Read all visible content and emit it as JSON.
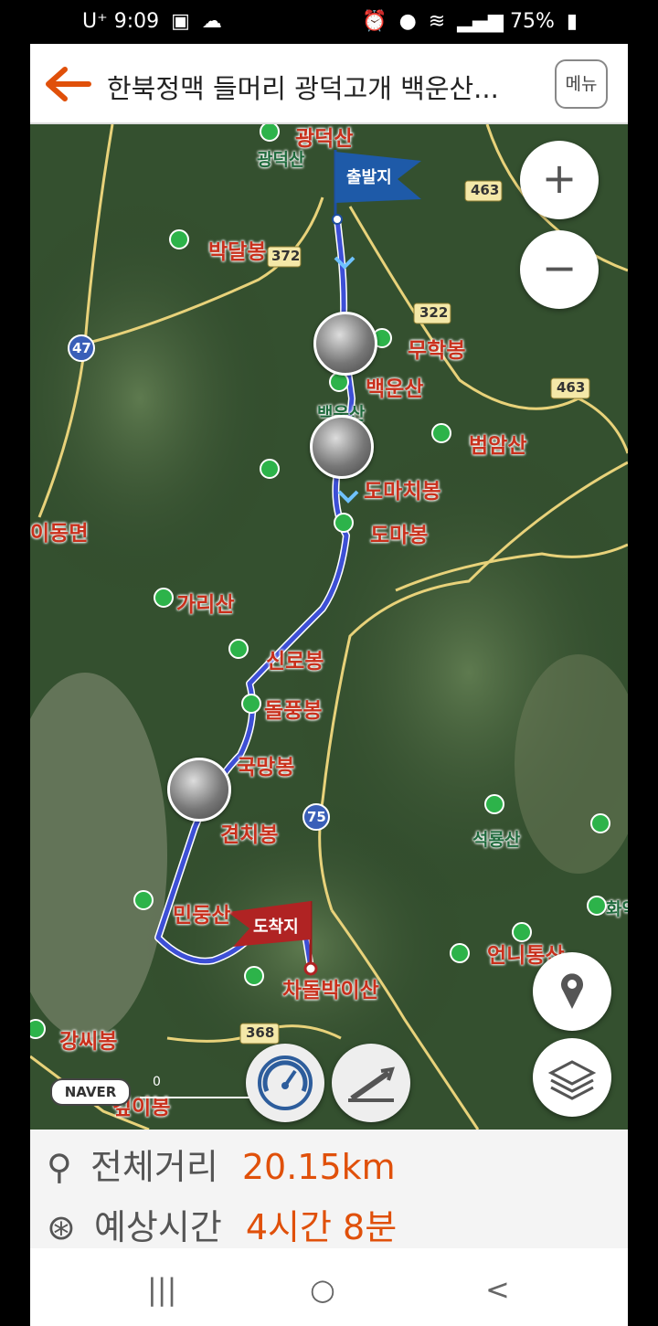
{
  "status": {
    "carrier": "U⁺",
    "time": "9:09",
    "battery": "75%"
  },
  "header": {
    "title": "한북정맥 들머리 광덕고개 백운산...",
    "menu_label": "메뉴"
  },
  "map": {
    "route_color": "#3d4fd6",
    "start_flag": "출발지",
    "end_flag": "도착지",
    "peaks": [
      "광덕산",
      "박달봉",
      "무학봉",
      "백운산",
      "범암산",
      "도마치봉",
      "도마봉",
      "가리산",
      "신로봉",
      "돌풍봉",
      "국망봉",
      "견치봉",
      "민둥산",
      "차돌박이산",
      "언니통산",
      "강씨봉",
      "깊이봉",
      "석룡산",
      "화악",
      "이동면",
      "백운산",
      "광덕산"
    ],
    "roads": [
      "463",
      "372",
      "322",
      "463",
      "47",
      "75",
      "368"
    ],
    "zoom_in": "+",
    "zoom_out": "−",
    "scale_text": "0",
    "naver": "NAVER"
  },
  "info": {
    "distance_label": "전체거리",
    "distance_value": "20.15km",
    "time_label": "예상시간",
    "time_value": "4시간 8분"
  },
  "navbar": {
    "recent": "|||",
    "home": "○",
    "back": "<"
  }
}
